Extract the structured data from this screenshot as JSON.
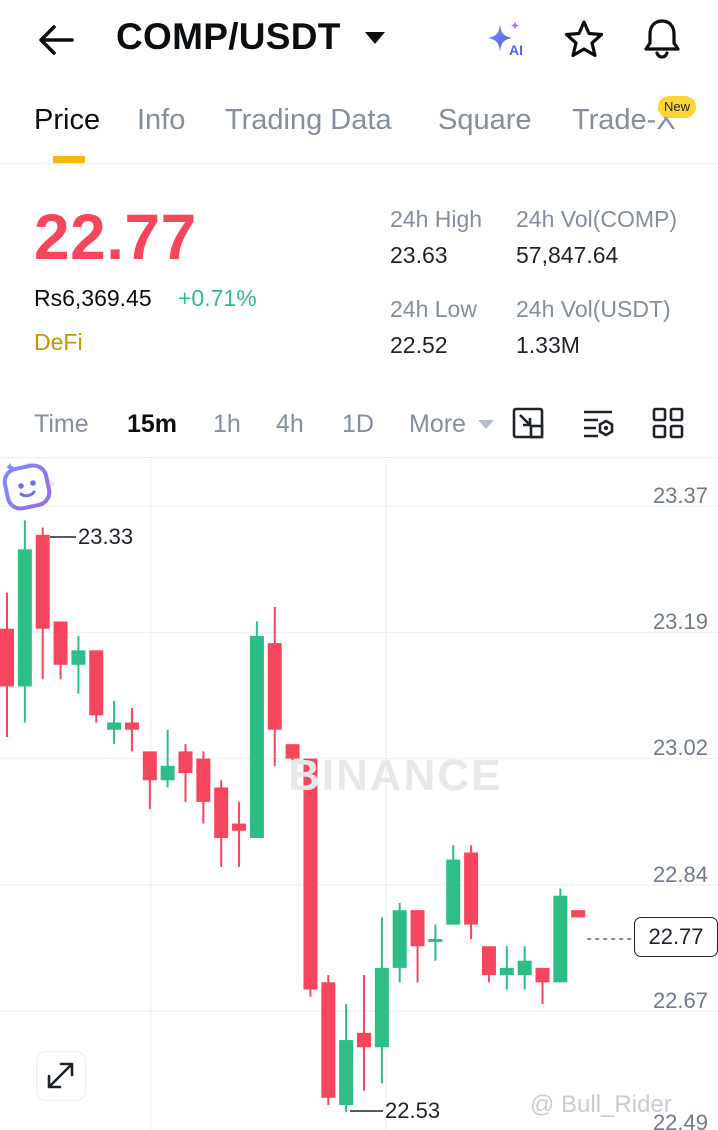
{
  "header": {
    "pair": "COMP/USDT",
    "back_icon": "arrow-left-icon",
    "ai_icon": "sparkle-ai-icon",
    "ai_label": "AI",
    "favorite_icon": "star-icon",
    "alert_icon": "bell-icon"
  },
  "tabs": [
    {
      "label": "Price",
      "active": true
    },
    {
      "label": "Info"
    },
    {
      "label": "Trading Data"
    },
    {
      "label": "Square"
    },
    {
      "label": "Trade-X",
      "badge": "New"
    }
  ],
  "ticker": {
    "last_price": "22.77",
    "fiat_price": "Rs6,369.45",
    "change_pct": "+0.71%",
    "sector": "DeFi"
  },
  "stats": {
    "high_label": "24h High",
    "high_value": "23.63",
    "low_label": "24h Low",
    "low_value": "22.52",
    "vol_base_label": "24h Vol(COMP)",
    "vol_base_value": "57,847.64",
    "vol_quote_label": "24h Vol(USDT)",
    "vol_quote_value": "1.33M"
  },
  "intervals": {
    "items": [
      "Time",
      "15m",
      "1h",
      "4h",
      "1D",
      "More"
    ],
    "selected": "15m",
    "tools": [
      "chart-fit-icon",
      "indicator-settings-icon",
      "layout-grid-icon"
    ]
  },
  "colors": {
    "up": "#2ebd85",
    "down": "#f6465d",
    "accent": "#f0b90b"
  },
  "chart": {
    "watermark": "BINANCE",
    "expand_icon": "expand-arrows-icon",
    "assistant_icon": "bot-face-icon",
    "credit": "@ Bull_Rider",
    "last_price_tag": "22.77",
    "high_marker": "23.33",
    "low_marker": "22.53",
    "axis_labels": [
      "23.37",
      "23.19",
      "23.02",
      "22.84",
      "22.67",
      "22.49"
    ]
  },
  "chart_data": {
    "type": "candlestick",
    "interval": "15m",
    "y_ticks": [
      23.37,
      23.19,
      23.02,
      22.84,
      22.67,
      22.49
    ],
    "last_price": 22.77,
    "candles": [
      {
        "o": 23.2,
        "h": 23.25,
        "l": 23.05,
        "c": 23.12
      },
      {
        "o": 23.12,
        "h": 23.35,
        "l": 23.07,
        "c": 23.31
      },
      {
        "o": 23.33,
        "h": 23.34,
        "l": 23.13,
        "c": 23.2
      },
      {
        "o": 23.21,
        "h": 23.21,
        "l": 23.13,
        "c": 23.15
      },
      {
        "o": 23.15,
        "h": 23.19,
        "l": 23.11,
        "c": 23.17
      },
      {
        "o": 23.17,
        "h": 23.17,
        "l": 23.07,
        "c": 23.08
      },
      {
        "o": 23.06,
        "h": 23.1,
        "l": 23.04,
        "c": 23.07
      },
      {
        "o": 23.07,
        "h": 23.09,
        "l": 23.03,
        "c": 23.06
      },
      {
        "o": 23.03,
        "h": 23.03,
        "l": 22.95,
        "c": 22.99
      },
      {
        "o": 22.99,
        "h": 23.06,
        "l": 22.98,
        "c": 23.01
      },
      {
        "o": 23.03,
        "h": 23.04,
        "l": 22.96,
        "c": 23.0
      },
      {
        "o": 23.02,
        "h": 23.03,
        "l": 22.93,
        "c": 22.96
      },
      {
        "o": 22.98,
        "h": 22.99,
        "l": 22.87,
        "c": 22.91
      },
      {
        "o": 22.93,
        "h": 22.96,
        "l": 22.87,
        "c": 22.92
      },
      {
        "o": 22.91,
        "h": 23.21,
        "l": 22.91,
        "c": 23.19
      },
      {
        "o": 23.18,
        "h": 23.23,
        "l": 23.01,
        "c": 23.06
      },
      {
        "o": 23.04,
        "h": 23.04,
        "l": 23.01,
        "c": 23.02
      },
      {
        "o": 23.02,
        "h": 23.02,
        "l": 22.69,
        "c": 22.7
      },
      {
        "o": 22.71,
        "h": 22.72,
        "l": 22.54,
        "c": 22.55
      },
      {
        "o": 22.54,
        "h": 22.68,
        "l": 22.53,
        "c": 22.63
      },
      {
        "o": 22.64,
        "h": 22.72,
        "l": 22.56,
        "c": 22.62
      },
      {
        "o": 22.62,
        "h": 22.8,
        "l": 22.57,
        "c": 22.73
      },
      {
        "o": 22.73,
        "h": 22.82,
        "l": 22.71,
        "c": 22.81
      },
      {
        "o": 22.81,
        "h": 22.81,
        "l": 22.71,
        "c": 22.76
      },
      {
        "o": 22.77,
        "h": 22.79,
        "l": 22.74,
        "c": 22.77
      },
      {
        "o": 22.79,
        "h": 22.9,
        "l": 22.79,
        "c": 22.88
      },
      {
        "o": 22.89,
        "h": 22.9,
        "l": 22.77,
        "c": 22.79
      },
      {
        "o": 22.76,
        "h": 22.76,
        "l": 22.71,
        "c": 22.72
      },
      {
        "o": 22.72,
        "h": 22.76,
        "l": 22.7,
        "c": 22.73
      },
      {
        "o": 22.72,
        "h": 22.76,
        "l": 22.7,
        "c": 22.74
      },
      {
        "o": 22.73,
        "h": 22.73,
        "l": 22.68,
        "c": 22.71
      },
      {
        "o": 22.71,
        "h": 22.84,
        "l": 22.71,
        "c": 22.83
      },
      {
        "o": 22.81,
        "h": 22.81,
        "l": 22.8,
        "c": 22.8
      }
    ]
  }
}
